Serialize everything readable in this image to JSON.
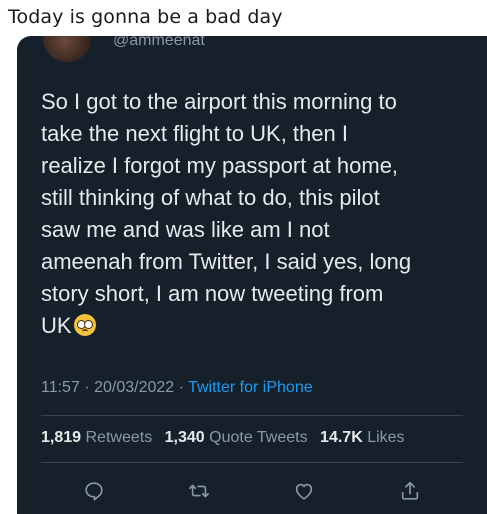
{
  "caption": "Today is gonna be a bad day",
  "tweet": {
    "handle": "@ammeenat",
    "text": "So I got to the airport this morning to\ntake the next flight to UK, then I\nrealize I forgot my passport at home,\nstill thinking of what to do, this pilot\nsaw me and was like am I not\nameenah from Twitter, I said yes, long\nstory short, I am now tweeting from\nUK",
    "emoji": "pleading-face-emoji",
    "time": "11:57",
    "dot": "·",
    "date": "20/03/2022",
    "source": "Twitter for iPhone"
  },
  "stats": {
    "retweets_count": "1,819",
    "retweets_label": "Retweets",
    "quotes_count": "1,340",
    "quotes_label": "Quote Tweets",
    "likes_count": "14.7K",
    "likes_label": "Likes"
  },
  "actions": [
    "reply-icon",
    "retweet-icon",
    "like-icon",
    "share-icon"
  ],
  "colors": {
    "background": "#15202b",
    "text": "#e7e9ea",
    "secondary": "#8b98a5",
    "accent": "#1d9bf0",
    "divider": "#38444d"
  }
}
